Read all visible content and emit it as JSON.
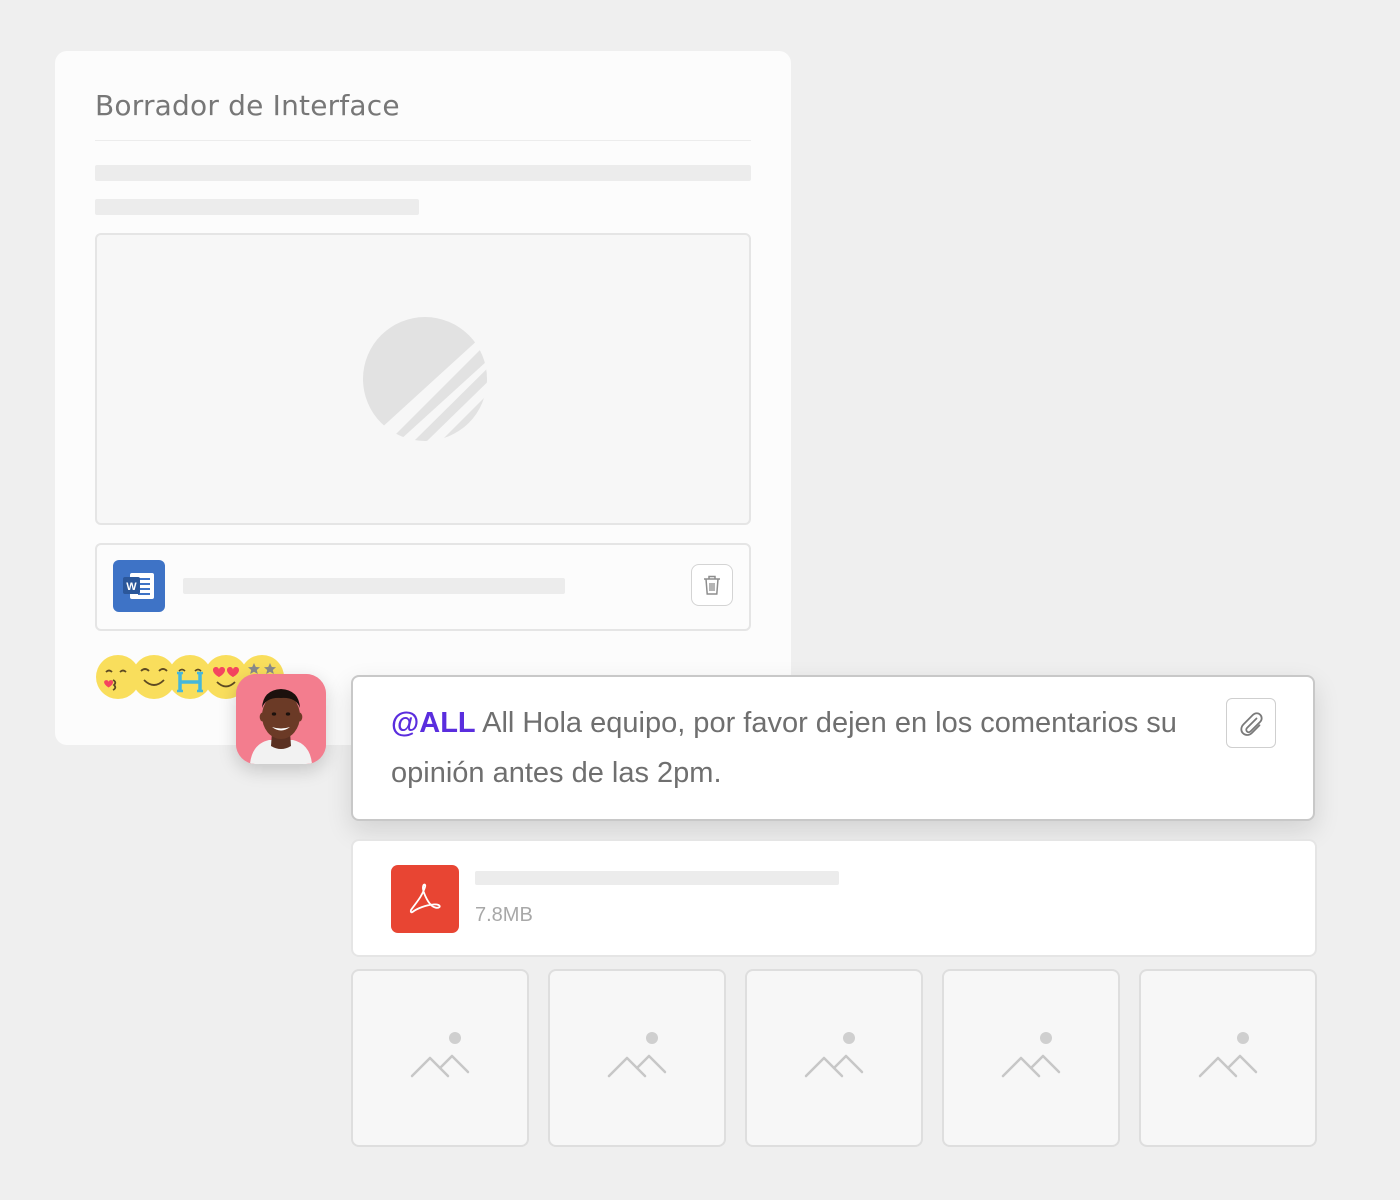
{
  "draft": {
    "title": "Borrador de Interface"
  },
  "reactions": [
    "face-blowing-kiss-icon",
    "smiling-face-icon",
    "h-letter-face-icon",
    "heart-eyes-face-icon",
    "star-eyes-face-icon"
  ],
  "message": {
    "mention": "@ALL",
    "text": "All Hola equipo, por favor dejen en los comentarios su opinión antes de las 2pm."
  },
  "attachment": {
    "size": "7.8MB"
  },
  "colors": {
    "background": "#efefef",
    "mention": "#5a2dde",
    "word_blue": "#3e73c6",
    "pdf_red": "#e84533",
    "avatar_pink": "#f37d8e"
  },
  "icons": {
    "doc": "word-document-icon",
    "delete": "trash-icon",
    "attach": "paperclip-icon",
    "pdf": "pdf-document-icon",
    "image": "image-placeholder-icon"
  }
}
